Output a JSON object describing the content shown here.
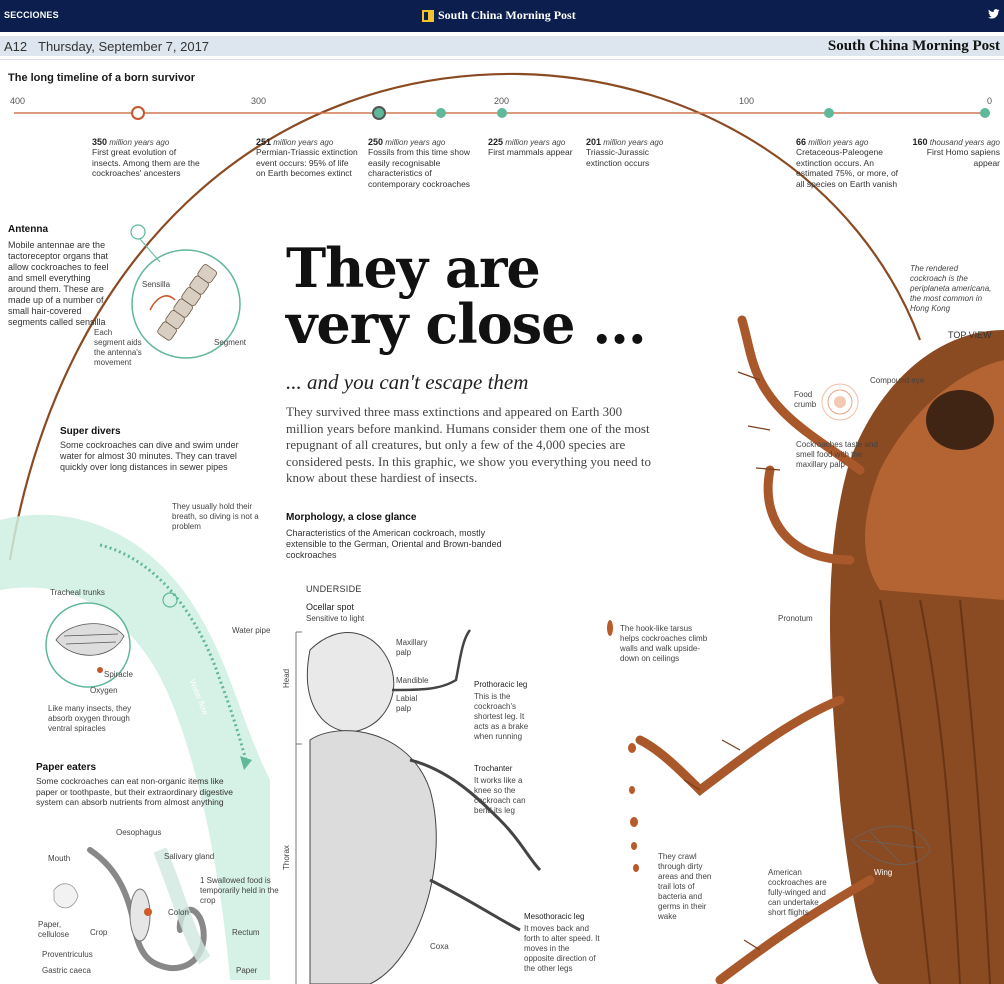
{
  "topbar": {
    "sections": "SECCIONES",
    "brand": "South China Morning Post",
    "share_icon": "twitter-icon"
  },
  "page": {
    "number": "A12",
    "date": "Thursday, September 7, 2017",
    "publication": "South China Morning Post"
  },
  "timeline": {
    "title": "The long timeline of a born survivor",
    "ticks": [
      "400",
      "300",
      "200",
      "100",
      "0"
    ],
    "events": [
      {
        "amount": "350",
        "unit": "million years ago",
        "text": "First great evolution of insects. Among them are the cockroaches' ancesters"
      },
      {
        "amount": "251",
        "unit": "million years ago",
        "text": "Permian-Triassic extinction event occurs: 95% of life on Earth becomes extinct"
      },
      {
        "amount": "250",
        "unit": "million years ago",
        "text": "Fossils from this time show easily recognisable characteristics of contemporary cockroaches"
      },
      {
        "amount": "225",
        "unit": "million years ago",
        "text": "First mammals appear"
      },
      {
        "amount": "201",
        "unit": "million years ago",
        "text": "Triassic-Jurassic extinction occurs"
      },
      {
        "amount": "66",
        "unit": "million years ago",
        "text": "Cretaceous-Paleogene extinction occurs. An estimated 75%, or more, of all species on Earth vanish"
      },
      {
        "amount": "160",
        "unit": "thousand years ago",
        "text": "First Homo sapiens appear"
      }
    ]
  },
  "antenna": {
    "title": "Antenna",
    "text": "Mobile antennae are the tactoreceptor organs that allow cockroaches to feel and smell everything around them. These are made up of a number of small hair-covered segments called sensilla",
    "labels": {
      "sensilla": "Sensilla",
      "segment": "Segment",
      "each_segment": "Each segment aids the antenna's movement"
    }
  },
  "super_divers": {
    "title": "Super divers",
    "text": "Some cockroaches can dive and swim under water for almost 30 minutes. They can travel quickly over long distances in sewer pipes",
    "hold_breath": "They usually hold their breath, so diving is not a problem",
    "tracheal": "Tracheal trunks",
    "spiracle": "Spiracle",
    "oxygen": "Oxygen",
    "water_pipe": "Water pipe",
    "water_flow": "Water flow",
    "spiracle_note": "Like many insects, they absorb oxygen through ventral spiracles"
  },
  "paper_eaters": {
    "title": "Paper eaters",
    "text": "Some cockroaches can eat non-organic items like paper or toothpaste, but their extraordinary digestive system can absorb nutrients from almost anything",
    "labels": {
      "oesophagus": "Oesophagus",
      "mouth": "Mouth",
      "salivary": "Salivary gland",
      "paper_cellulose": "Paper, cellulose",
      "crop": "Crop",
      "colon": "Colon",
      "rectum": "Rectum",
      "proventriculus": "Proventriculus",
      "gastric": "Gastric caeca",
      "paper": "Paper",
      "step1": "1  Swallowed food is temporarily held in the crop"
    }
  },
  "headline": {
    "line1": "They are",
    "line2": "very close ...",
    "sub": "... and you can't escape them"
  },
  "intro": "They survived three mass extinctions and appeared on Earth 300 million years before mankind. Humans consider them one of the most repugnant of all creatures, but only a few of the 4,000 species are considered pests. In this graphic, we show you everything you need to know about these hardiest of insects.",
  "morphology": {
    "title": "Morphology, a close glance",
    "text": "Characteristics of the American cockroach, mostly extensible to the German, Oriental and Brown-banded cockroaches"
  },
  "underside": {
    "title": "UNDERSIDE",
    "ocellar": "Ocellar spot",
    "ocellar_sub": "Sensitive to light",
    "maxillary": "Maxillary palp",
    "mandible": "Mandible",
    "labial": "Labial palp",
    "head": "Head",
    "thorax": "Thorax",
    "prothoracic": "Prothoracic leg",
    "prothoracic_text": "This is the cockroach's shortest leg. It acts as a brake when running",
    "trochanter": "Trochanter",
    "trochanter_text": "It works like a knee so the cockroach can bend its leg",
    "mesothoracic": "Mesothoracic leg",
    "mesothoracic_text": "It moves back and forth to alter speed. It moves in the opposite direction of the other legs",
    "coxa": "Coxa"
  },
  "topview": {
    "render_note": "The rendered cockroach is the periplaneta americana, the most common in Hong Kong",
    "title": "TOP VIEW",
    "compound_eye": "Compound eye",
    "food_crumb": "Food crumb",
    "taste": "Cockroaches taste and smell food with the maxillary palp",
    "pronotum": "Pronotum",
    "hook": "The hook-like tarsus helps cockroaches climb walls and walk upside-down on ceilings",
    "crawl": "They crawl through dirty areas and then trail lots of bacteria and germs in their wake",
    "wing": "Wing",
    "winged": "American cockroaches are fully-winged and can undertake short flights"
  },
  "colors": {
    "nav": "#0b1e4e",
    "accent": "#c9562a",
    "timeline_green": "#5fb89a",
    "roach": "#8a4a22",
    "water": "#bfe6da"
  }
}
